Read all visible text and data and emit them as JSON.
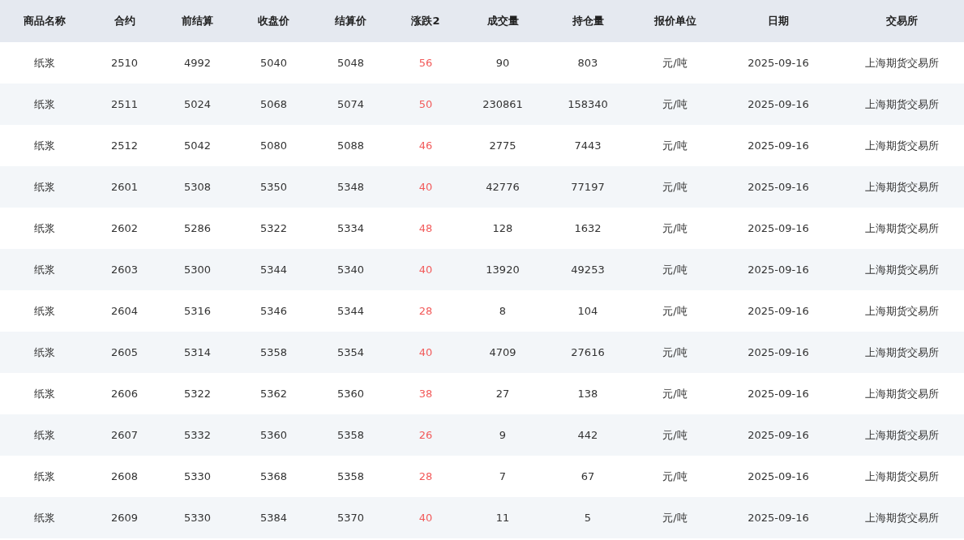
{
  "table": {
    "columns": [
      "商品名称",
      "合约",
      "前结算",
      "收盘价",
      "结算价",
      "涨跌2",
      "成交量",
      "持仓量",
      "报价单位",
      "日期",
      "交易所"
    ],
    "rows": [
      [
        "纸浆",
        "2510",
        "4992",
        "5040",
        "5048",
        "56",
        "90",
        "803",
        "元/吨",
        "2025-09-16",
        "上海期货交易所"
      ],
      [
        "纸浆",
        "2511",
        "5024",
        "5068",
        "5074",
        "50",
        "230861",
        "158340",
        "元/吨",
        "2025-09-16",
        "上海期货交易所"
      ],
      [
        "纸浆",
        "2512",
        "5042",
        "5080",
        "5088",
        "46",
        "2775",
        "7443",
        "元/吨",
        "2025-09-16",
        "上海期货交易所"
      ],
      [
        "纸浆",
        "2601",
        "5308",
        "5350",
        "5348",
        "40",
        "42776",
        "77197",
        "元/吨",
        "2025-09-16",
        "上海期货交易所"
      ],
      [
        "纸浆",
        "2602",
        "5286",
        "5322",
        "5334",
        "48",
        "128",
        "1632",
        "元/吨",
        "2025-09-16",
        "上海期货交易所"
      ],
      [
        "纸浆",
        "2603",
        "5300",
        "5344",
        "5340",
        "40",
        "13920",
        "49253",
        "元/吨",
        "2025-09-16",
        "上海期货交易所"
      ],
      [
        "纸浆",
        "2604",
        "5316",
        "5346",
        "5344",
        "28",
        "8",
        "104",
        "元/吨",
        "2025-09-16",
        "上海期货交易所"
      ],
      [
        "纸浆",
        "2605",
        "5314",
        "5358",
        "5354",
        "40",
        "4709",
        "27616",
        "元/吨",
        "2025-09-16",
        "上海期货交易所"
      ],
      [
        "纸浆",
        "2606",
        "5322",
        "5362",
        "5360",
        "38",
        "27",
        "138",
        "元/吨",
        "2025-09-16",
        "上海期货交易所"
      ],
      [
        "纸浆",
        "2607",
        "5332",
        "5360",
        "5358",
        "26",
        "9",
        "442",
        "元/吨",
        "2025-09-16",
        "上海期货交易所"
      ],
      [
        "纸浆",
        "2608",
        "5330",
        "5368",
        "5358",
        "28",
        "7",
        "67",
        "元/吨",
        "2025-09-16",
        "上海期货交易所"
      ],
      [
        "纸浆",
        "2609",
        "5330",
        "5384",
        "5370",
        "40",
        "11",
        "5",
        "元/吨",
        "2025-09-16",
        "上海期货交易所"
      ]
    ]
  }
}
